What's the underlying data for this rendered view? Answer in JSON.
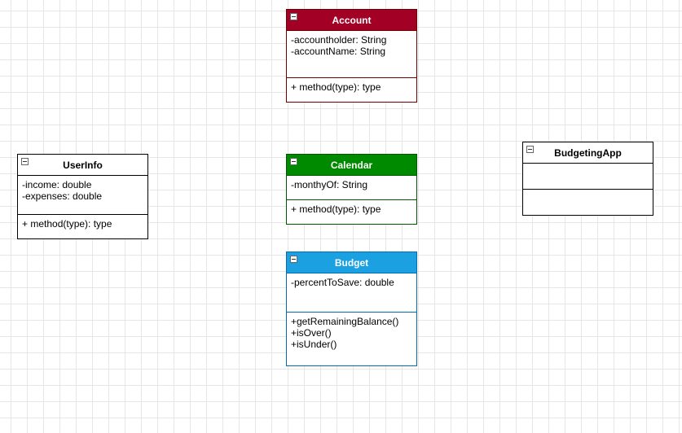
{
  "classes": {
    "account": {
      "name": "Account",
      "header_color": "#a20025",
      "header_text_color": "#ffffff",
      "border_color": "#6f0000",
      "attributes": [
        "-accountholder: String",
        "-accountName: String"
      ],
      "methods": [
        "+ method(type): type"
      ]
    },
    "userinfo": {
      "name": "UserInfo",
      "header_color": "#ffffff",
      "header_text_color": "#000000",
      "border_color": "#000000",
      "attributes": [
        "-income: double",
        "-expenses: double"
      ],
      "methods": [
        "+ method(type): type"
      ]
    },
    "calendar": {
      "name": "Calendar",
      "header_color": "#008a00",
      "header_text_color": "#ffffff",
      "border_color": "#005700",
      "attributes": [
        "-monthyOf: String"
      ],
      "methods": [
        "+ method(type): type"
      ]
    },
    "budgetingapp": {
      "name": "BudgetingApp",
      "header_color": "#ffffff",
      "header_text_color": "#000000",
      "border_color": "#000000",
      "attributes": [],
      "methods": []
    },
    "budget": {
      "name": "Budget",
      "header_color": "#1ba1e2",
      "header_text_color": "#ffffff",
      "border_color": "#006eaf",
      "attributes": [
        "-percentToSave: double"
      ],
      "methods": [
        "+getRemainingBalance()",
        "+isOver()",
        "+isUnder()"
      ]
    }
  }
}
